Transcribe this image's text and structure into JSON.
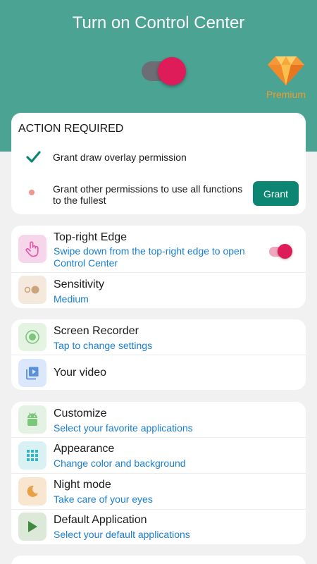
{
  "header": {
    "title": "Turn on Control Center",
    "premium_label": "Premium",
    "master_toggle_on": true
  },
  "action_required": {
    "title": "ACTION REQUIRED",
    "items": [
      {
        "text": "Grant draw overlay permission",
        "status": "done"
      },
      {
        "text": "Grant other permissions to use all functions to the fullest",
        "status": "pending"
      }
    ],
    "grant_label": "Grant"
  },
  "edge_card": {
    "top_right_edge": {
      "title": "Top-right Edge",
      "subtitle": "Swipe down from the top-right edge to open Control Center",
      "enabled": true,
      "icon": "hand-pointer-icon"
    },
    "sensitivity": {
      "title": "Sensitivity",
      "subtitle": "Medium",
      "icon": "toggle-dots-icon"
    }
  },
  "recorder_card": {
    "screen_recorder": {
      "title": "Screen Recorder",
      "subtitle": "Tap to change settings",
      "icon": "record-icon"
    },
    "your_video": {
      "title": "Your video",
      "icon": "video-library-icon"
    }
  },
  "settings_card": {
    "customize": {
      "title": "Customize",
      "subtitle": "Select your favorite applications",
      "icon": "android-icon"
    },
    "appearance": {
      "title": "Appearance",
      "subtitle": "Change color and background",
      "icon": "grid-icon"
    },
    "night_mode": {
      "title": "Night mode",
      "subtitle": "Take care of your eyes",
      "icon": "moon-icon"
    },
    "default_app": {
      "title": "Default Application",
      "subtitle": "Select your default applications",
      "icon": "play-icon"
    }
  },
  "colors": {
    "header_bg": "#4aa393",
    "accent_pink": "#de1c5a",
    "link_blue": "#1a7ed0",
    "grant_button": "#0d8573",
    "premium_orange": "#f39a2c"
  }
}
